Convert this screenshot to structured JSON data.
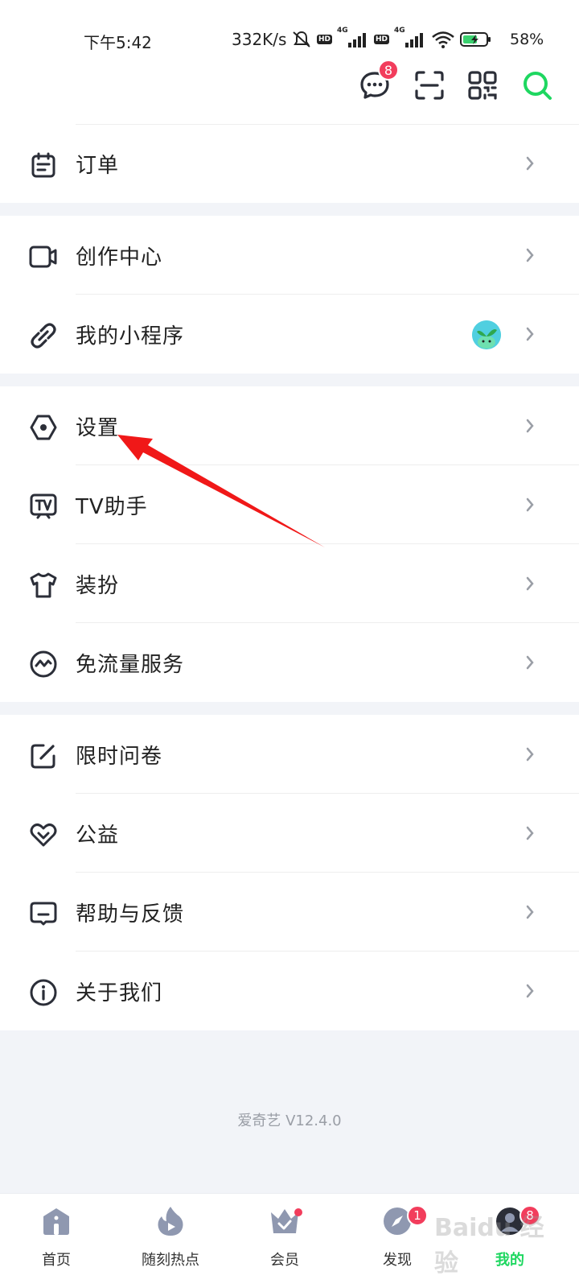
{
  "status_bar": {
    "time": "下午5:42",
    "network_speed": "332K/s",
    "battery_percent": "58%",
    "signal_1": "4G",
    "signal_2": "4G",
    "hd_label": "HD"
  },
  "top_actions": {
    "message_badge": "8"
  },
  "menu": {
    "orders": "订单",
    "creator_center": "创作中心",
    "mini_programs": "我的小程序",
    "settings": "设置",
    "tv_assistant": "TV助手",
    "dress_up": "装扮",
    "free_data": "免流量服务",
    "survey": "限时问卷",
    "charity": "公益",
    "help_feedback": "帮助与反馈",
    "about_us": "关于我们"
  },
  "version": "爱奇艺 V12.4.0",
  "bottom_nav": {
    "items": [
      {
        "label": "首页"
      },
      {
        "label": "随刻热点"
      },
      {
        "label": "会员"
      },
      {
        "label": "发现",
        "badge": "1"
      },
      {
        "label": "我的",
        "badge": "8"
      }
    ]
  },
  "colors": {
    "accent_green": "#1ed760",
    "badge_red": "#f23d5c",
    "annotation_arrow": "#f01818",
    "icon_dark": "#2b2e38"
  },
  "watermark": "Baidu 经验"
}
